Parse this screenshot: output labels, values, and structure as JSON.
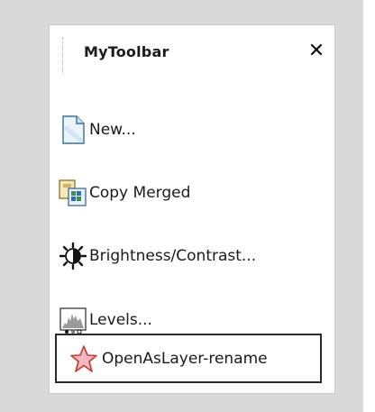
{
  "toolbar": {
    "title": "MyToolbar",
    "close_label": "×",
    "items": [
      {
        "label": "New...",
        "icon": "new-document-icon"
      },
      {
        "label": "Copy Merged",
        "icon": "copy-merged-icon"
      },
      {
        "label": "Brightness/Contrast...",
        "icon": "brightness-contrast-icon"
      },
      {
        "label": "Levels...",
        "icon": "levels-icon"
      },
      {
        "label": "OpenAsLayer-rename",
        "icon": "star-icon",
        "selected": true
      }
    ]
  },
  "colors": {
    "background": "#d9d9d9",
    "panel": "#ffffff",
    "selected_border": "#2a2a2a",
    "star_fill": "#f7b6c2",
    "star_stroke": "#c0392b"
  }
}
